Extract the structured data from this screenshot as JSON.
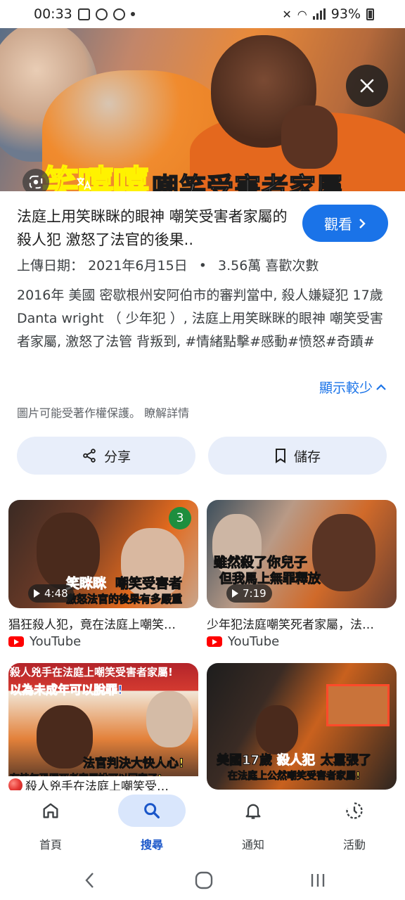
{
  "status_bar": {
    "time": "00:33",
    "battery": "93%"
  },
  "hero": {
    "caption_highlight": "笑嘻嘻",
    "caption_text": "嘲笑受害者家屬"
  },
  "detail": {
    "title": "法庭上用笑眯眯的眼神 嘲笑受害者家屬的殺人犯 激怒了法官的後果..",
    "watch_label": "觀看",
    "upload_label": "上傳日期：",
    "upload_date": "2021年6月15日",
    "likes": "3.56萬 喜歡次數",
    "description": "2016年 美國 密歇根州安阿伯市的審判當中, 殺人嫌疑犯 17歲 Danta wright （ 少年犯 ）, 法庭上用笑眯眯的眼神 嘲笑受害者家屬, 激怒了法管 背叛到, #情緒點擊#感動#愤怒#奇蹟#",
    "show_less": "顯示較少",
    "copyright": "圖片可能受著作權保護。 瞭解詳情",
    "share_label": "分享",
    "save_label": "儲存"
  },
  "results": [
    {
      "caption_a": "笑眯眯",
      "caption_b": "嘲笑受害者",
      "caption_c": "激怒法官的後果有多嚴重",
      "duration": "4:48",
      "badge": "3",
      "title": "猖狂殺人犯，竟在法庭上嘲笑…",
      "source": "YouTube"
    },
    {
      "caption_a": "雖然殺了你兒子",
      "caption_b": "但我馬上無罪釋放",
      "duration": "7:19",
      "title": "少年犯法庭嘲笑死者家屬，法…",
      "source": "YouTube"
    },
    {
      "caption_a": "殺人兇手在法庭上嘲笑受害者家屬!",
      "caption_b": "以為未成年可以脫罪!",
      "caption_c": "法官判決大快人心!",
      "caption_d": "有恃無恐跟死者家屬說可以回家了!",
      "title": "殺人兇手在法庭上嘲笑受…"
    },
    {
      "caption_a": "美國17歲",
      "caption_b": "殺人犯",
      "caption_c": "太囂張了",
      "caption_d": "在法庭上公然嘲笑受害者家屬!"
    }
  ],
  "bottom_nav": {
    "home": "首頁",
    "search": "搜尋",
    "notifications": "通知",
    "activity": "活動"
  },
  "colors": {
    "accent": "#1a73e8",
    "pill_bg": "#e8eefa",
    "nav_active_bg": "#d9e6fc"
  }
}
